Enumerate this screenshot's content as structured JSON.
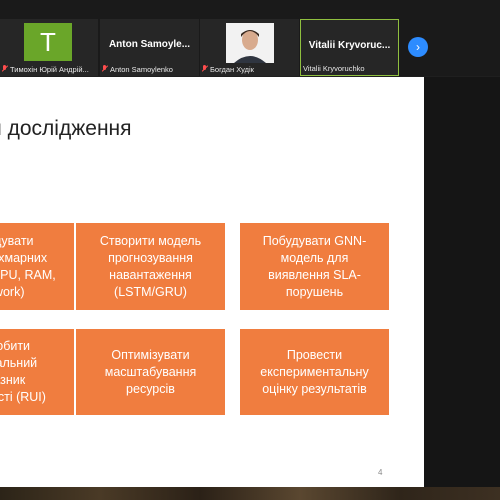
{
  "participants": [
    {
      "tile_name": "",
      "label": "Тимохін Юрій Андрій...",
      "avatar_letter": "T",
      "muted": true
    },
    {
      "tile_name": "Anton Samoyle...",
      "label": "Anton Samoylenko",
      "muted": true
    },
    {
      "tile_name": "",
      "label": "Богдан Худік",
      "muted": true
    },
    {
      "tile_name": "Vitalii Kryvoruc...",
      "label": "Vitalii Kryvoruchko",
      "muted": false
    }
  ],
  "next_button": "›",
  "slide": {
    "title": "Завдання дослідження",
    "boxes": [
      {
        "text": "Побудувати\nмодель хмарних\nметрик (CPU, RAM,\nNetwork)"
      },
      {
        "text": "Створити модель\nпрогнозування\nнавантаження\n(LSTM/GRU)"
      },
      {
        "text": "Побудувати GNN-\nмодель для\nвиявлення SLA-\nпорушень"
      },
      {
        "text": "Розробити\nінтегральний\nпоказник\nнадійності (RUI)"
      },
      {
        "text": "Оптимізувати\nмасштабування\nресурсів"
      },
      {
        "text": "Провести\nекспериментальну\nоцінку результатів"
      }
    ],
    "page_number": "4"
  },
  "colors": {
    "box": "#f07d3f",
    "accent": "#2d8cff",
    "active_border": "#8fbf3f"
  }
}
